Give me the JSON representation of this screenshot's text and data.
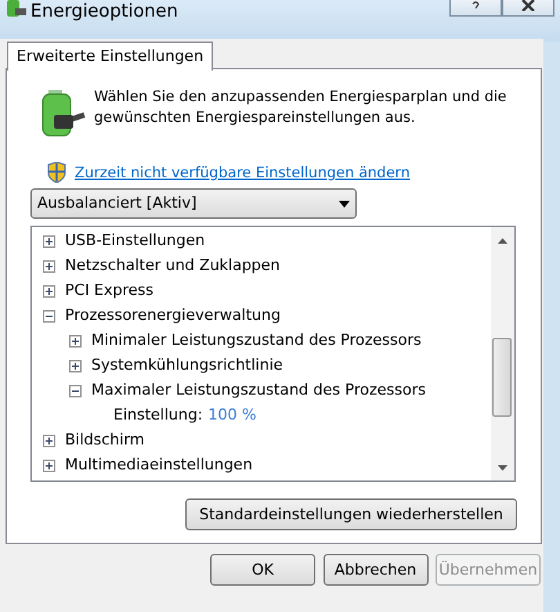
{
  "window": {
    "title": "Energieoptionen"
  },
  "tabs": [
    {
      "label": "Erweiterte Einstellungen",
      "selected": true
    }
  ],
  "description": "Wählen Sie den anzupassenden Energiesparplan und die gewünschten Energiespareinstellungen aus.",
  "admin_link": "Zurzeit nicht verfügbare Einstellungen ändern",
  "plan_select": {
    "value": "Ausbalanciert [Aktiv]"
  },
  "tree": [
    {
      "label": "USB-Einstellungen",
      "expanded": false
    },
    {
      "label": "Netzschalter und Zuklappen",
      "expanded": false
    },
    {
      "label": "PCI Express",
      "expanded": false
    },
    {
      "label": "Prozessorenergieverwaltung",
      "expanded": true,
      "children": [
        {
          "label": "Minimaler Leistungszustand des Prozessors",
          "expanded": false
        },
        {
          "label": "Systemkühlungsrichtlinie",
          "expanded": false
        },
        {
          "label": "Maximaler Leistungszustand des Prozessors",
          "expanded": true,
          "setting": {
            "label": "Einstellung:",
            "value": "100 %"
          }
        }
      ]
    },
    {
      "label": "Bildschirm",
      "expanded": false
    },
    {
      "label": "Multimediaeinstellungen",
      "expanded": false
    }
  ],
  "restore_button": "Standardeinstellungen wiederherstellen",
  "buttons": [
    {
      "label": "OK",
      "disabled": false
    },
    {
      "label": "Abbrechen",
      "disabled": false
    },
    {
      "label": "Übernehmen",
      "disabled": true
    }
  ]
}
